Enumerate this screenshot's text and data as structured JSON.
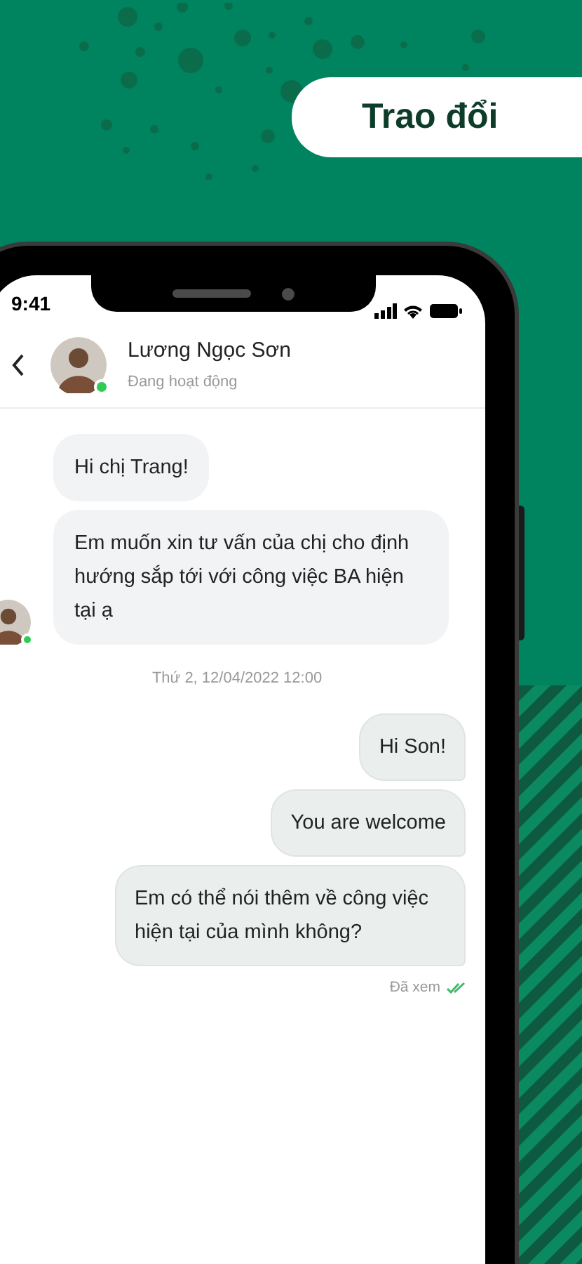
{
  "banner": {
    "title": "Trao đổi"
  },
  "status_bar": {
    "time": "9:41"
  },
  "chat_header": {
    "name": "Lương Ngọc Sơn",
    "status": "Đang hoạt động",
    "online": true
  },
  "messages": [
    {
      "kind": "received",
      "text": "Hi chị Trang!",
      "show_avatar": false
    },
    {
      "kind": "received",
      "text": "Em muốn xin tư vấn của chị cho định hướng sắp tới với công việc BA hiện tại ạ",
      "show_avatar": true
    },
    {
      "kind": "timestamp",
      "text": "Thứ 2, 12/04/2022 12:00"
    },
    {
      "kind": "sent",
      "text": "Hi Son!"
    },
    {
      "kind": "sent",
      "text": "You are welcome"
    },
    {
      "kind": "sent",
      "text": "Em có thể nói thêm về công việc hiện tại của mình không?"
    }
  ],
  "read_receipt": {
    "text": "Đã xem",
    "seen": true
  }
}
